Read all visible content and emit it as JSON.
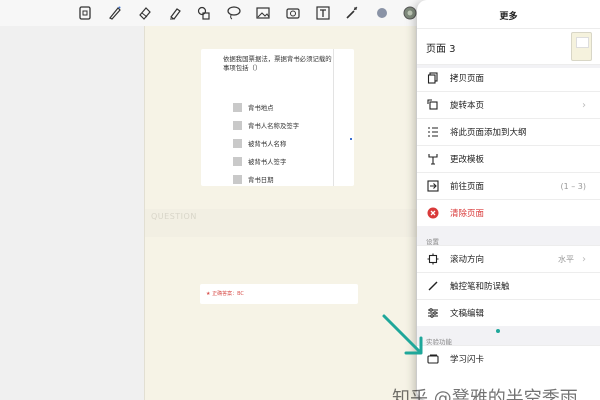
{
  "toolbar": {
    "tools": [
      "document-icon",
      "pen-icon",
      "eraser-icon",
      "highlighter-icon",
      "shapes-icon",
      "lasso-icon",
      "image-icon",
      "camera-icon",
      "text-icon",
      "laser-icon",
      "color-dot-icon",
      "active-tool-icon"
    ]
  },
  "page_content": {
    "question_text": "依据我国票据法，票据背书必须记载的事项包括（）",
    "options": [
      "背书地点",
      "背书人名称及签字",
      "被背书人名称",
      "被背书人签字",
      "背书日期"
    ],
    "section_label": "QUESTION",
    "answer_text": "★ 正确答案：BC"
  },
  "menu": {
    "title": "更多",
    "page_label": "页面 3",
    "items_top": [
      {
        "label": "拷贝页面",
        "icon": "copy-icon"
      },
      {
        "label": "旋转本页",
        "icon": "rotate-icon",
        "chevron": "›"
      },
      {
        "label": "将此页面添加到大纲",
        "icon": "outline-icon"
      },
      {
        "label": "更改模板",
        "icon": "template-icon"
      },
      {
        "label": "前往页面",
        "icon": "goto-icon",
        "right": "(1 – 3)"
      },
      {
        "label": "清除页面",
        "icon": "clear-icon",
        "danger": true
      }
    ],
    "settings_label": "设置",
    "items_settings": [
      {
        "label": "滚动方向",
        "icon": "scroll-direction-icon",
        "right": "水平",
        "chevron": "›"
      },
      {
        "label": "触控笔和防误触",
        "icon": "stylus-icon"
      },
      {
        "label": "文稿编辑",
        "icon": "sliders-icon"
      }
    ],
    "experimental_label": "实验功能",
    "items_experimental": [
      {
        "label": "学习闪卡",
        "icon": "flashcard-icon"
      }
    ]
  },
  "watermark": "知乎 @凳雅的半空季雨",
  "colors": {
    "accent_teal": "#1fa79a",
    "danger": "#d93a3a",
    "page_bg": "#f6f3e6"
  }
}
